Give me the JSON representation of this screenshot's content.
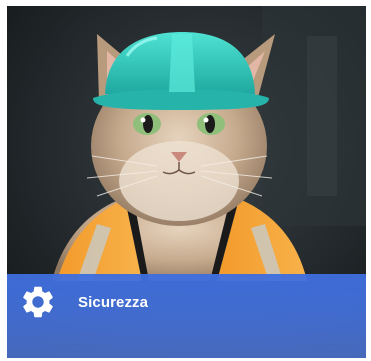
{
  "tile": {
    "label": "Sicurezza",
    "icon": "gear-icon",
    "image_subject": "cat-wearing-hard-hat-and-safety-vest",
    "accent_color": "#3f6fdc"
  }
}
